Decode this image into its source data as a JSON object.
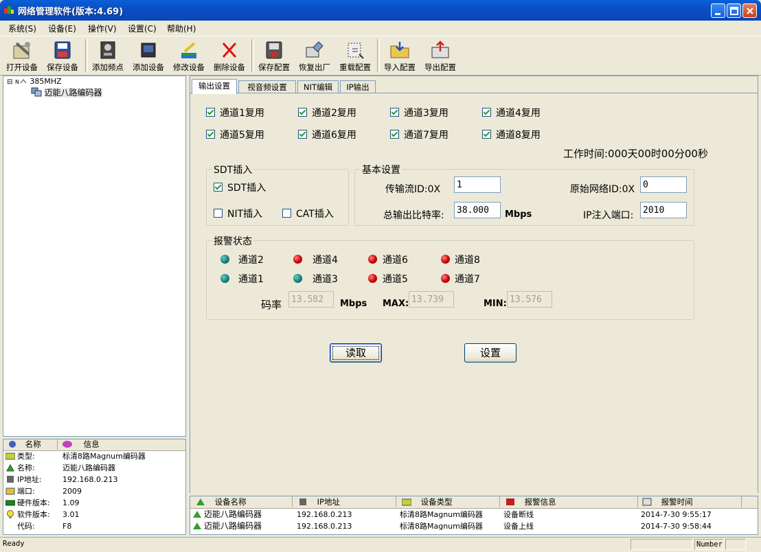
{
  "window": {
    "title": "网络管理软件(版本:4.69)"
  },
  "menu": [
    "系统(S)",
    "设备(E)",
    "操作(V)",
    "设置(C)",
    "帮助(H)"
  ],
  "toolbar": [
    "打开设备",
    "保存设备",
    "添加频点",
    "添加设备",
    "修改设备",
    "删除设备",
    "保存配置",
    "恢复出厂",
    "重载配置",
    "导入配置",
    "导出配置"
  ],
  "tree": {
    "root": "385MHZ",
    "child": "迈能八路编码器",
    "expander": "⊟"
  },
  "info": {
    "headers": [
      "名称",
      "信息"
    ],
    "rows": [
      {
        "label": "类型:",
        "value": "标清8路Magnum编码器"
      },
      {
        "label": "名称:",
        "value": "迈能八路编码器"
      },
      {
        "label": "IP地址:",
        "value": "192.168.0.213"
      },
      {
        "label": "端口:",
        "value": "2009"
      },
      {
        "label": "硬件版本:",
        "value": "1.09"
      },
      {
        "label": "软件版本:",
        "value": "3.01"
      },
      {
        "label": "代码:",
        "value": "F8"
      }
    ]
  },
  "tabs": [
    "输出设置",
    "视音频设置",
    "NIT编辑",
    "IP输出"
  ],
  "channels": [
    "通道1复用",
    "通道2复用",
    "通道3复用",
    "通道4复用",
    "通道5复用",
    "通道6复用",
    "通道7复用",
    "通道8复用"
  ],
  "work_time": "工作时间:000天00时00分00秒",
  "sdt": {
    "title": "SDT插入",
    "sdt_label": "SDT插入",
    "sdt_checked": true,
    "nit_label": "NIT插入",
    "nit_checked": false,
    "cat_label": "CAT插入",
    "cat_checked": false
  },
  "basic": {
    "title": "基本设置",
    "ts_id_label": "传输流ID:0X",
    "ts_id_value": "1",
    "orig_net_label": "原始网络ID:0X",
    "orig_net_value": "0",
    "bitrate_label": "总输出比特率:",
    "bitrate_value": "38.000",
    "bitrate_unit": "Mbps",
    "ip_port_label": "IP注入端口:",
    "ip_port_value": "2010"
  },
  "alarm": {
    "title": "报警状态",
    "leds": [
      {
        "label": "通道2",
        "status": "green"
      },
      {
        "label": "通道4",
        "status": "red"
      },
      {
        "label": "通道6",
        "status": "red"
      },
      {
        "label": "通道8",
        "status": "red"
      },
      {
        "label": "通道1",
        "status": "green"
      },
      {
        "label": "通道3",
        "status": "green"
      },
      {
        "label": "通道5",
        "status": "red"
      },
      {
        "label": "通道7",
        "status": "red"
      }
    ],
    "rate_label": "码率",
    "rate_value": "13.582",
    "rate_unit": "Mbps",
    "max_label": "MAX:",
    "max_value": "13.739",
    "min_label": "MIN:",
    "min_value": "13.576"
  },
  "buttons": {
    "read": "读取",
    "set": "设置"
  },
  "log": {
    "headers": [
      "设备名称",
      "IP地址",
      "设备类型",
      "报警信息",
      "报警时间"
    ],
    "rows": [
      [
        "迈能八路编码器",
        "192.168.0.213",
        "标清8路Magnum编码器",
        "设备断线",
        "2014-7-30  9:55:17"
      ],
      [
        "迈能八路编码器",
        "192.168.0.213",
        "标清8路Magnum编码器",
        "设备上线",
        "2014-7-30  9:58:44"
      ]
    ]
  },
  "status": {
    "left": "Ready",
    "right": "Number"
  },
  "colors": {
    "titlebar": "#0b4fc4",
    "led_green": "#0b6a6a",
    "led_red": "#cc0000"
  }
}
